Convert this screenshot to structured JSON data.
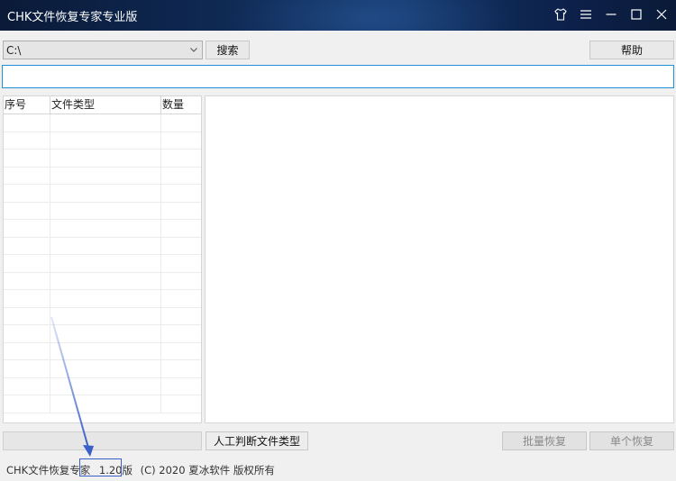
{
  "window": {
    "title": "CHK文件恢复专家专业版",
    "icons": [
      "shirt-icon",
      "menu-icon",
      "minimize-icon",
      "maximize-icon",
      "close-icon"
    ]
  },
  "toolbar": {
    "drive_value": "C:\\",
    "search_label": "搜索",
    "help_label": "帮助"
  },
  "path_input": {
    "value": ""
  },
  "grid": {
    "headers": [
      "序号",
      "文件类型",
      "数量"
    ],
    "rows": 17
  },
  "bottom": {
    "detect_label": "人工判断文件类型",
    "batch_label": "批量恢复",
    "single_label": "单个恢复"
  },
  "status": {
    "prefix": "CHK文件恢复专家",
    "version": "1.20版",
    "suffix": "(C) 2020 夏冰软件 版权所有"
  },
  "colors": {
    "titlebar": "#0f2a55",
    "input_border": "#1f8fd8",
    "annotation": "#3a5fc8"
  }
}
